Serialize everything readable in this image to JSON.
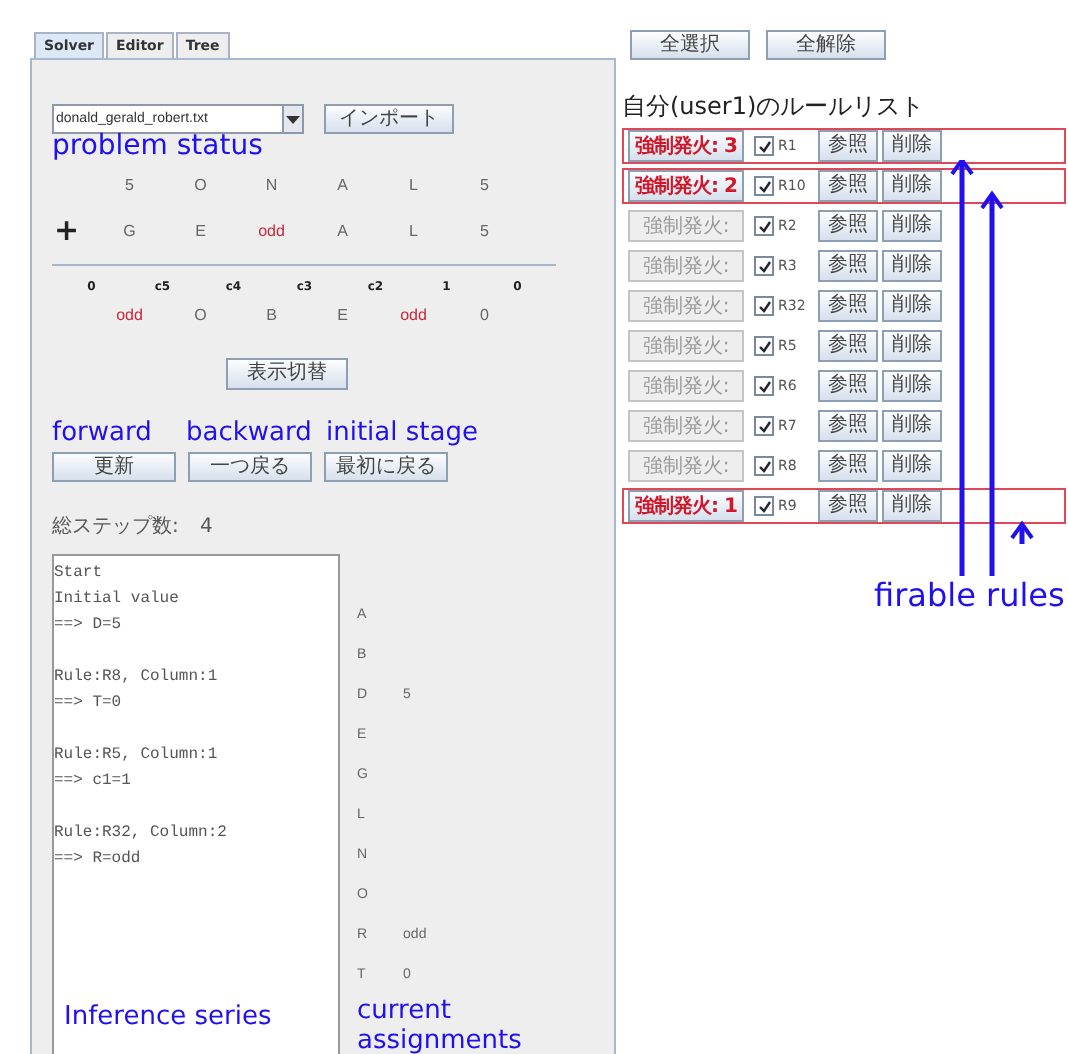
{
  "tabs": [
    {
      "label": "Solver",
      "selected": true
    },
    {
      "label": "Editor",
      "selected": false
    },
    {
      "label": "Tree",
      "selected": false
    }
  ],
  "problem": {
    "file": "donald_gerald_robert.txt",
    "import_button": "インポート"
  },
  "puzzle": {
    "operator": "+",
    "addends": [
      [
        {
          "text": "5",
          "highlighted": false
        },
        {
          "text": "O",
          "highlighted": false
        },
        {
          "text": "N",
          "highlighted": false
        },
        {
          "text": "A",
          "highlighted": false
        },
        {
          "text": "L",
          "highlighted": false
        },
        {
          "text": "5",
          "highlighted": false
        }
      ],
      [
        {
          "text": "G",
          "highlighted": false
        },
        {
          "text": "E",
          "highlighted": false
        },
        {
          "text": "odd",
          "highlighted": true
        },
        {
          "text": "A",
          "highlighted": false
        },
        {
          "text": "L",
          "highlighted": false
        },
        {
          "text": "5",
          "highlighted": false
        }
      ]
    ],
    "carries": [
      "0",
      "c5",
      "c4",
      "c3",
      "c2",
      "1",
      "0"
    ],
    "result": [
      {
        "text": "odd",
        "highlighted": true
      },
      {
        "text": "O",
        "highlighted": false
      },
      {
        "text": "B",
        "highlighted": false
      },
      {
        "text": "E",
        "highlighted": false
      },
      {
        "text": "odd",
        "highlighted": true
      },
      {
        "text": "0",
        "highlighted": false
      }
    ]
  },
  "toggle_button": "表示切替",
  "nav_buttons": [
    "更新",
    "一つ戻る",
    "最初に戻る"
  ],
  "steps": {
    "label": "総ステップ数:",
    "count": "4"
  },
  "log": [
    [
      "Start",
      "Initial value",
      "==> D=5"
    ],
    [
      "Rule:R8, Column:1",
      "==> T=0"
    ],
    [
      "Rule:R5, Column:1",
      "==> c1=1"
    ],
    [
      "Rule:R32, Column:2",
      "==> R=odd"
    ]
  ],
  "assignments": [
    {
      "variable": "A"
    },
    {
      "variable": "B"
    },
    {
      "variable": "D",
      "value": "5"
    },
    {
      "variable": "E"
    },
    {
      "variable": "G"
    },
    {
      "variable": "L"
    },
    {
      "variable": "N"
    },
    {
      "variable": "O"
    },
    {
      "variable": "R",
      "value": "odd"
    },
    {
      "variable": "T",
      "value": "0"
    }
  ],
  "rule_buttons": [
    "全選択",
    "全解除"
  ],
  "rule_list_title": "自分(user1)のルールリスト",
  "rules": [
    {
      "fire": "強制発火: 3",
      "firable": true,
      "checked": true,
      "name": "R1",
      "view": "参照",
      "delete": "削除"
    },
    {
      "fire": "強制発火: 2",
      "firable": true,
      "checked": true,
      "name": "R10",
      "view": "参照",
      "delete": "削除"
    },
    {
      "fire": "強制発火:",
      "firable": false,
      "checked": true,
      "name": "R2",
      "view": "参照",
      "delete": "削除"
    },
    {
      "fire": "強制発火:",
      "firable": false,
      "checked": true,
      "name": "R3",
      "view": "参照",
      "delete": "削除"
    },
    {
      "fire": "強制発火:",
      "firable": false,
      "checked": true,
      "name": "R32",
      "view": "参照",
      "delete": "削除"
    },
    {
      "fire": "強制発火:",
      "firable": false,
      "checked": true,
      "name": "R5",
      "view": "参照",
      "delete": "削除"
    },
    {
      "fire": "強制発火:",
      "firable": false,
      "checked": true,
      "name": "R6",
      "view": "参照",
      "delete": "削除"
    },
    {
      "fire": "強制発火:",
      "firable": false,
      "checked": true,
      "name": "R7",
      "view": "参照",
      "delete": "削除"
    },
    {
      "fire": "強制発火:",
      "firable": false,
      "checked": true,
      "name": "R8",
      "view": "参照",
      "delete": "削除"
    },
    {
      "fire": "強制発火: 1",
      "firable": true,
      "checked": true,
      "name": "R9",
      "view": "参照",
      "delete": "削除"
    }
  ],
  "annotations": {
    "problem_status": "problem status",
    "forward": "forward",
    "backward": "backward",
    "initial_stage": "initial stage",
    "inference_series": "Inference series",
    "current_assignments": "current assignments",
    "firable_rules": "firable rules"
  }
}
